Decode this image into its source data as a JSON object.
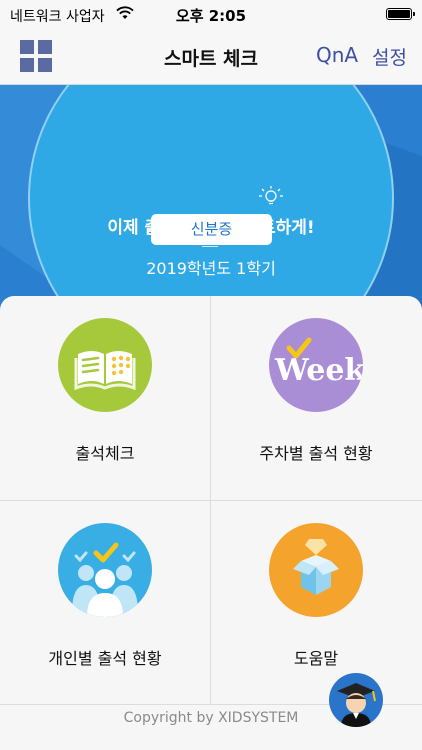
{
  "status_bar": {
    "carrier": "네트워크 사업자",
    "time": "오후 2:05",
    "wifi_icon": "wifi-icon",
    "battery_icon": "battery-icon"
  },
  "nav": {
    "title": "스마트 체크",
    "qna": "QnA",
    "settings": "설정",
    "menu_icon": "grid-menu-icon"
  },
  "banner": {
    "headline": "이제 출석관리도 스마트하게!",
    "semester": "2019학년도 1학기",
    "id_button": "신분증",
    "icon": "lightbulb-icon"
  },
  "menu": [
    {
      "label": "출석체크",
      "icon": "book-icon",
      "color": "#a6c93c"
    },
    {
      "label": "주차별 출석 현황",
      "icon": "week-icon",
      "color": "#a98ed6"
    },
    {
      "label": "개인별 출석 현황",
      "icon": "people-icon",
      "color": "#38aee4"
    },
    {
      "label": "도움말",
      "icon": "help-box-icon",
      "color": "#f4a42c"
    }
  ],
  "footer": {
    "copyright": "Copyright by XIDSYSTEM",
    "mascot_icon": "graduate-mascot-icon"
  },
  "colors": {
    "accent": "#3f4fa3",
    "banner": "#2b7fd0",
    "banner_circle": "#2fa8e6"
  }
}
